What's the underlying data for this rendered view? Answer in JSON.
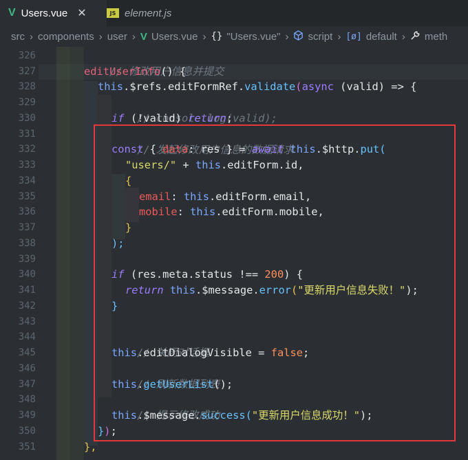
{
  "tabs": [
    {
      "label": "Users.vue",
      "icon": "vue-icon",
      "active": true
    },
    {
      "label": "element.js",
      "icon": "js-icon",
      "active": false
    }
  ],
  "js_icon_text": "JS",
  "close_glyph": "✕",
  "breadcrumb": {
    "items": [
      "src",
      "components",
      "user",
      "Users.vue",
      "\"Users.vue\"",
      "script",
      "default",
      "meth"
    ],
    "braces": "{}",
    "module": "[ø]",
    "sep": "›"
  },
  "line_numbers": [
    "326",
    "327",
    "328",
    "329",
    "330",
    "331",
    "332",
    "333",
    "334",
    "335",
    "336",
    "337",
    "338",
    "339",
    "340",
    "341",
    "342",
    "343",
    "344",
    "345",
    "346",
    "347",
    "348",
    "349",
    "350",
    "351"
  ],
  "code": {
    "l326": "// 修改用户信息并提交",
    "l327_fn": "editUserInfo",
    "l327_rest": "() {",
    "l328_this": "this",
    "l328_a": ".$refs.editFormRef.",
    "l328_m": "validate",
    "l328_p1": "(",
    "l328_async": "async",
    "l328_b": " (valid) => {",
    "l329": "// console.log(valid);",
    "l330_if": "if",
    "l330_b": " (!valid) ",
    "l330_ret": "return",
    "l330_c": ";",
    "l331": "// 发起修改用户信息的数据请求",
    "l332_const": "const",
    "l332_a": " { ",
    "l332_data": "data",
    "l332_b": ": res } = ",
    "l332_await": "await",
    "l332_this": "this",
    "l332_c": ".$http.",
    "l332_put": "put",
    "l332_d": "(",
    "l333_str": "\"users/\"",
    "l333_a": " + ",
    "l333_this": "this",
    "l333_b": ".editForm.id,",
    "l334": "{",
    "l335_key": "email",
    "l335_a": ": ",
    "l335_this": "this",
    "l335_b": ".editForm.email,",
    "l336_key": "mobile",
    "l336_a": ": ",
    "l336_this": "this",
    "l336_b": ".editForm.mobile,",
    "l337": "}",
    "l338": ");",
    "l340_if": "if",
    "l340_a": " (res.meta.status !== ",
    "l340_num": "200",
    "l340_b": ") {",
    "l341_ret": "return",
    "l341_this": "this",
    "l341_a": ".$message.",
    "l341_m": "error",
    "l341_p": "(",
    "l341_str": "\"更新用户信息失败！\"",
    "l341_b": ");",
    "l342": "}",
    "l344": "// 关闭对话框",
    "l345_this": "this",
    "l345_a": ".editDialogVisible = ",
    "l345_false": "false",
    "l345_b": ";",
    "l346": "// 刷新数据列表",
    "l347_this": "this",
    "l347_a": ".",
    "l347_m": "getUserList",
    "l347_b": "();",
    "l348": "// 提示修改成功",
    "l349_this": "this",
    "l349_a": ".$message.",
    "l349_m": "success",
    "l349_p": "(",
    "l349_str": "\"更新用户信息成功！\"",
    "l349_b": ");",
    "l350_brace": "}",
    "l350_paren": ")",
    "l350_b": ";",
    "l351": "},"
  },
  "colors": {
    "background": "#2b2f33",
    "highlight_box": "#e53939",
    "vue_green": "#41b883"
  }
}
